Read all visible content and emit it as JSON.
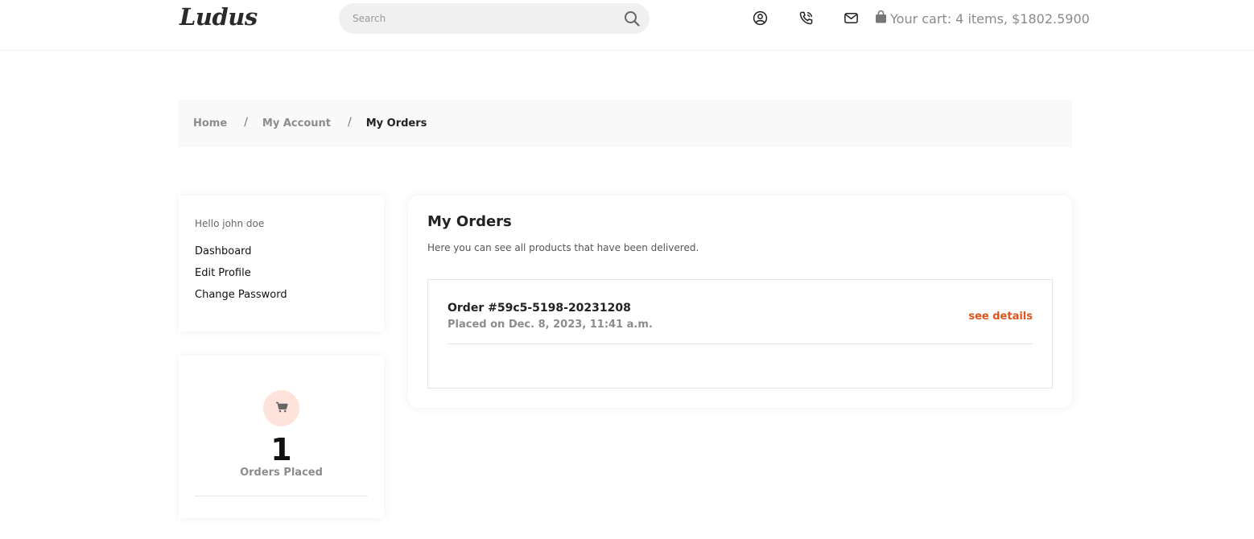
{
  "header": {
    "logo": "Ludus",
    "search": {
      "placeholder": "Search",
      "value": ""
    },
    "icons": [
      "user-circle-icon",
      "phone-icon",
      "mail-icon",
      "shopping-bag-icon"
    ],
    "cart_text": "Your cart: 4 items, $1802.5900"
  },
  "breadcrumb": {
    "items": [
      "Home",
      "My Account",
      "My Orders"
    ],
    "separator": "/"
  },
  "sidebar": {
    "greeting": "Hello john doe",
    "links": [
      "Dashboard",
      "Edit Profile",
      "Change Password"
    ]
  },
  "stats": {
    "icon": "cart-icon",
    "count": "1",
    "label": "Orders Placed"
  },
  "main": {
    "title": "My Orders",
    "subtitle": "Here you can see all products that have been delivered.",
    "orders": [
      {
        "id": "Order #59c5-5198-20231208",
        "placed": "Placed on Dec. 8, 2023, 11:41 a.m.",
        "link_label": "see details"
      }
    ]
  },
  "colors": {
    "accent": "#e0541c",
    "icon_bg": "#fde3dc",
    "muted_text": "#8c8c8c",
    "breadcrumb_bg": "#f9f9f9"
  }
}
